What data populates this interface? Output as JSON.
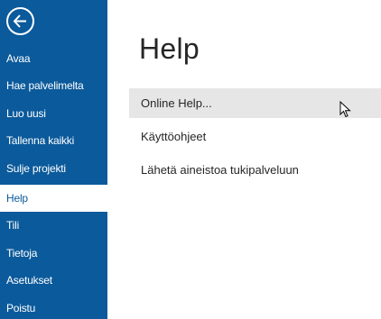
{
  "sidebar": {
    "back_icon": "arrow-left-circle-icon",
    "items": [
      {
        "label": "Avaa"
      },
      {
        "label": "Hae palvelimelta"
      },
      {
        "label": "Luo uusi"
      },
      {
        "label": "Tallenna kaikki"
      },
      {
        "label": "Sulje projekti"
      },
      {
        "label": "Help",
        "active": true
      },
      {
        "label": "Tili"
      },
      {
        "label": "Tietoja"
      },
      {
        "label": "Asetukset"
      },
      {
        "label": "Poistu"
      }
    ]
  },
  "main": {
    "title": "Help",
    "options": [
      {
        "label": "Online Help...",
        "hovered": true
      },
      {
        "label": "Käyttöohjeet"
      },
      {
        "label": "Lähetä aineistoa tukipalveluun"
      }
    ]
  },
  "colors": {
    "sidebar_bg": "#0b5a9b",
    "active_item_bg": "#ffffff",
    "hover_bg": "#e6e6e6"
  },
  "pointer_icon": "mouse-pointer-icon"
}
